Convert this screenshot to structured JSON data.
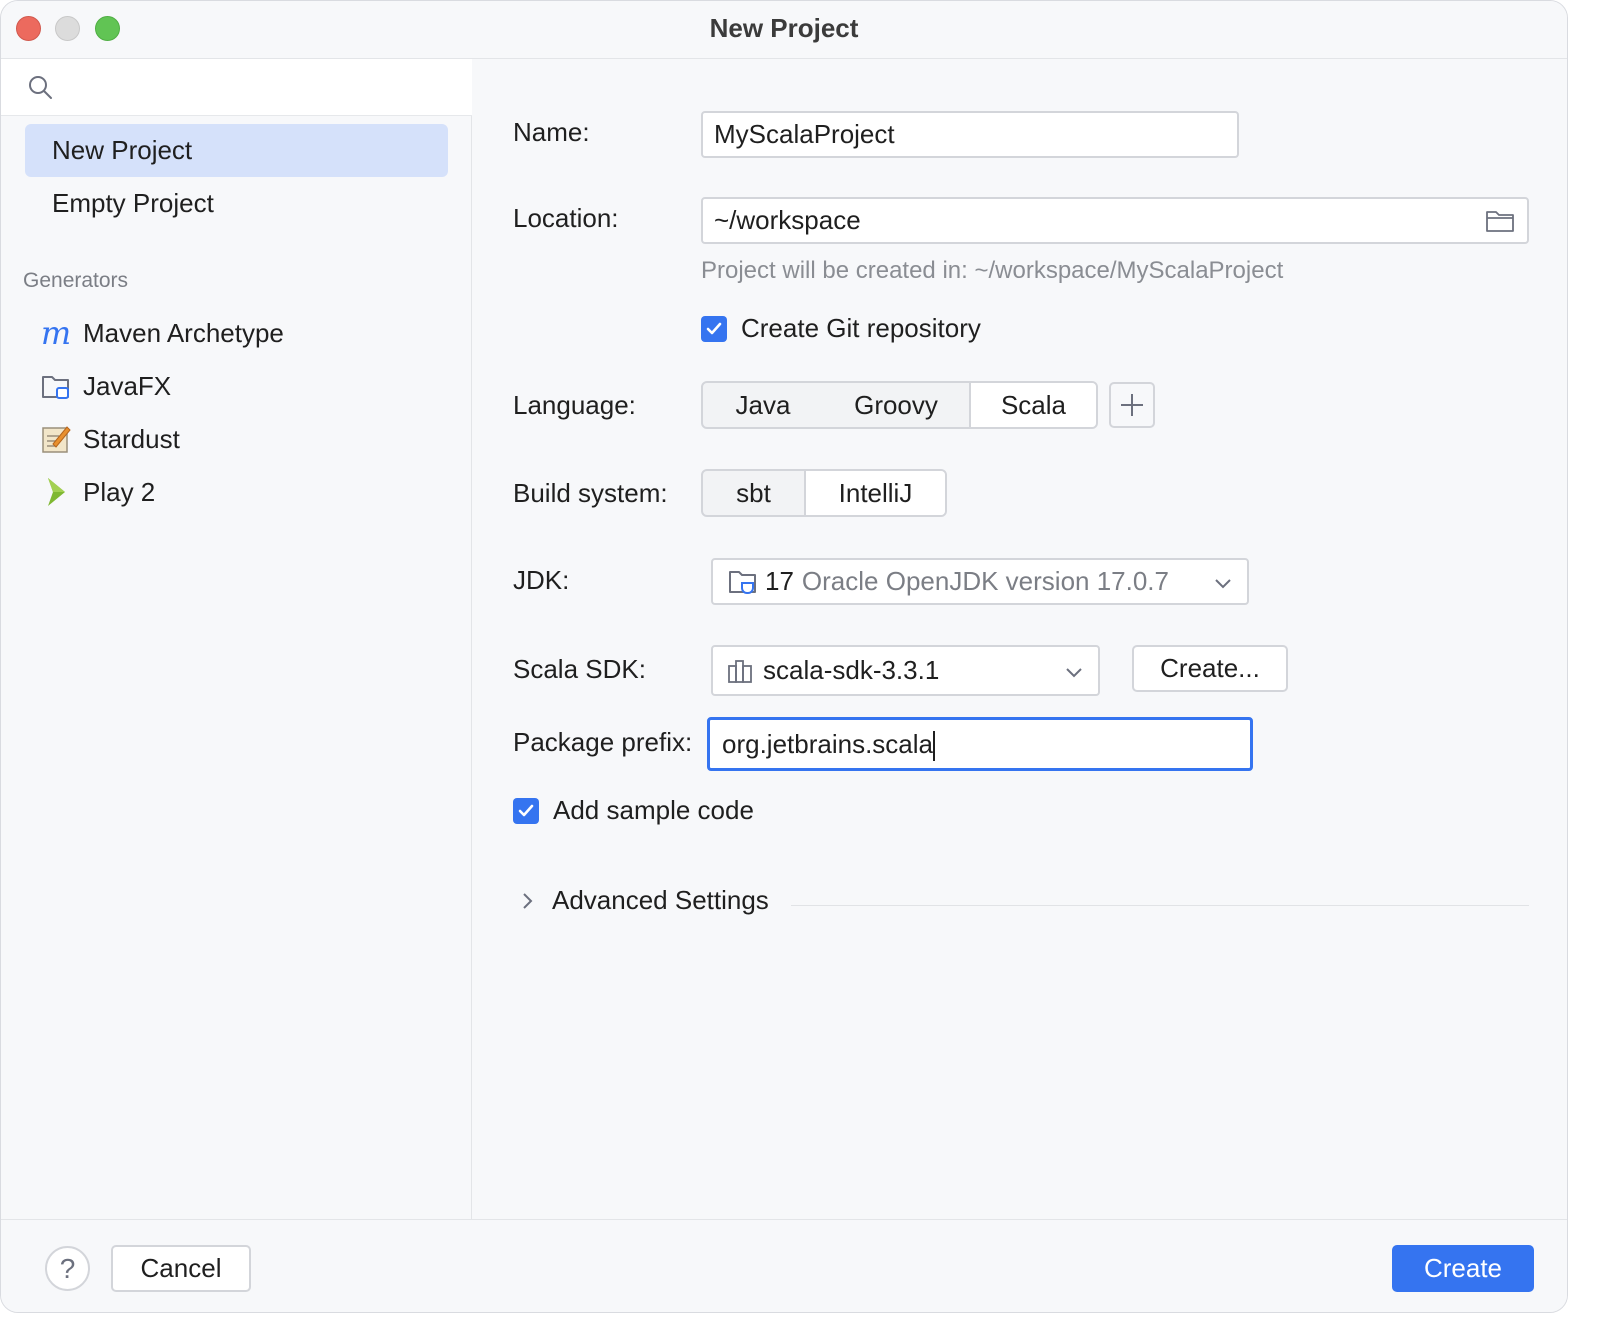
{
  "window": {
    "title": "New Project"
  },
  "sidebar": {
    "search": {
      "placeholder": ""
    },
    "items": [
      {
        "label": "New Project",
        "selected": true
      },
      {
        "label": "Empty Project",
        "selected": false
      }
    ],
    "generators_label": "Generators",
    "generators": [
      {
        "label": "Maven Archetype",
        "icon": "maven-icon"
      },
      {
        "label": "JavaFX",
        "icon": "javafx-folder-icon"
      },
      {
        "label": "Stardust",
        "icon": "stardust-icon"
      },
      {
        "label": "Play 2",
        "icon": "play2-icon"
      }
    ]
  },
  "form": {
    "name": {
      "label": "Name:",
      "value": "MyScalaProject"
    },
    "location": {
      "label": "Location:",
      "value": "~/workspace",
      "hint": "Project will be created in: ~/workspace/MyScalaProject"
    },
    "git": {
      "label": "Create Git repository",
      "checked": true
    },
    "language": {
      "label": "Language:",
      "options": [
        "Java",
        "Groovy",
        "Scala"
      ],
      "selected": "Scala"
    },
    "build": {
      "label": "Build system:",
      "options": [
        "sbt",
        "IntelliJ"
      ],
      "selected": "IntelliJ"
    },
    "jdk": {
      "label": "JDK:",
      "version": "17",
      "description": "Oracle OpenJDK version 17.0.7"
    },
    "scala_sdk": {
      "label": "Scala SDK:",
      "value": "scala-sdk-3.3.1",
      "create_label": "Create..."
    },
    "package_prefix": {
      "label": "Package prefix:",
      "value": "org.jetbrains.scala"
    },
    "sample_code": {
      "label": "Add sample code",
      "checked": true
    },
    "advanced": {
      "label": "Advanced Settings"
    }
  },
  "footer": {
    "help": "?",
    "cancel": "Cancel",
    "create": "Create"
  },
  "colors": {
    "accent": "#3574f0",
    "selection": "#d5e1fa",
    "hint_text": "#8a8d93"
  }
}
